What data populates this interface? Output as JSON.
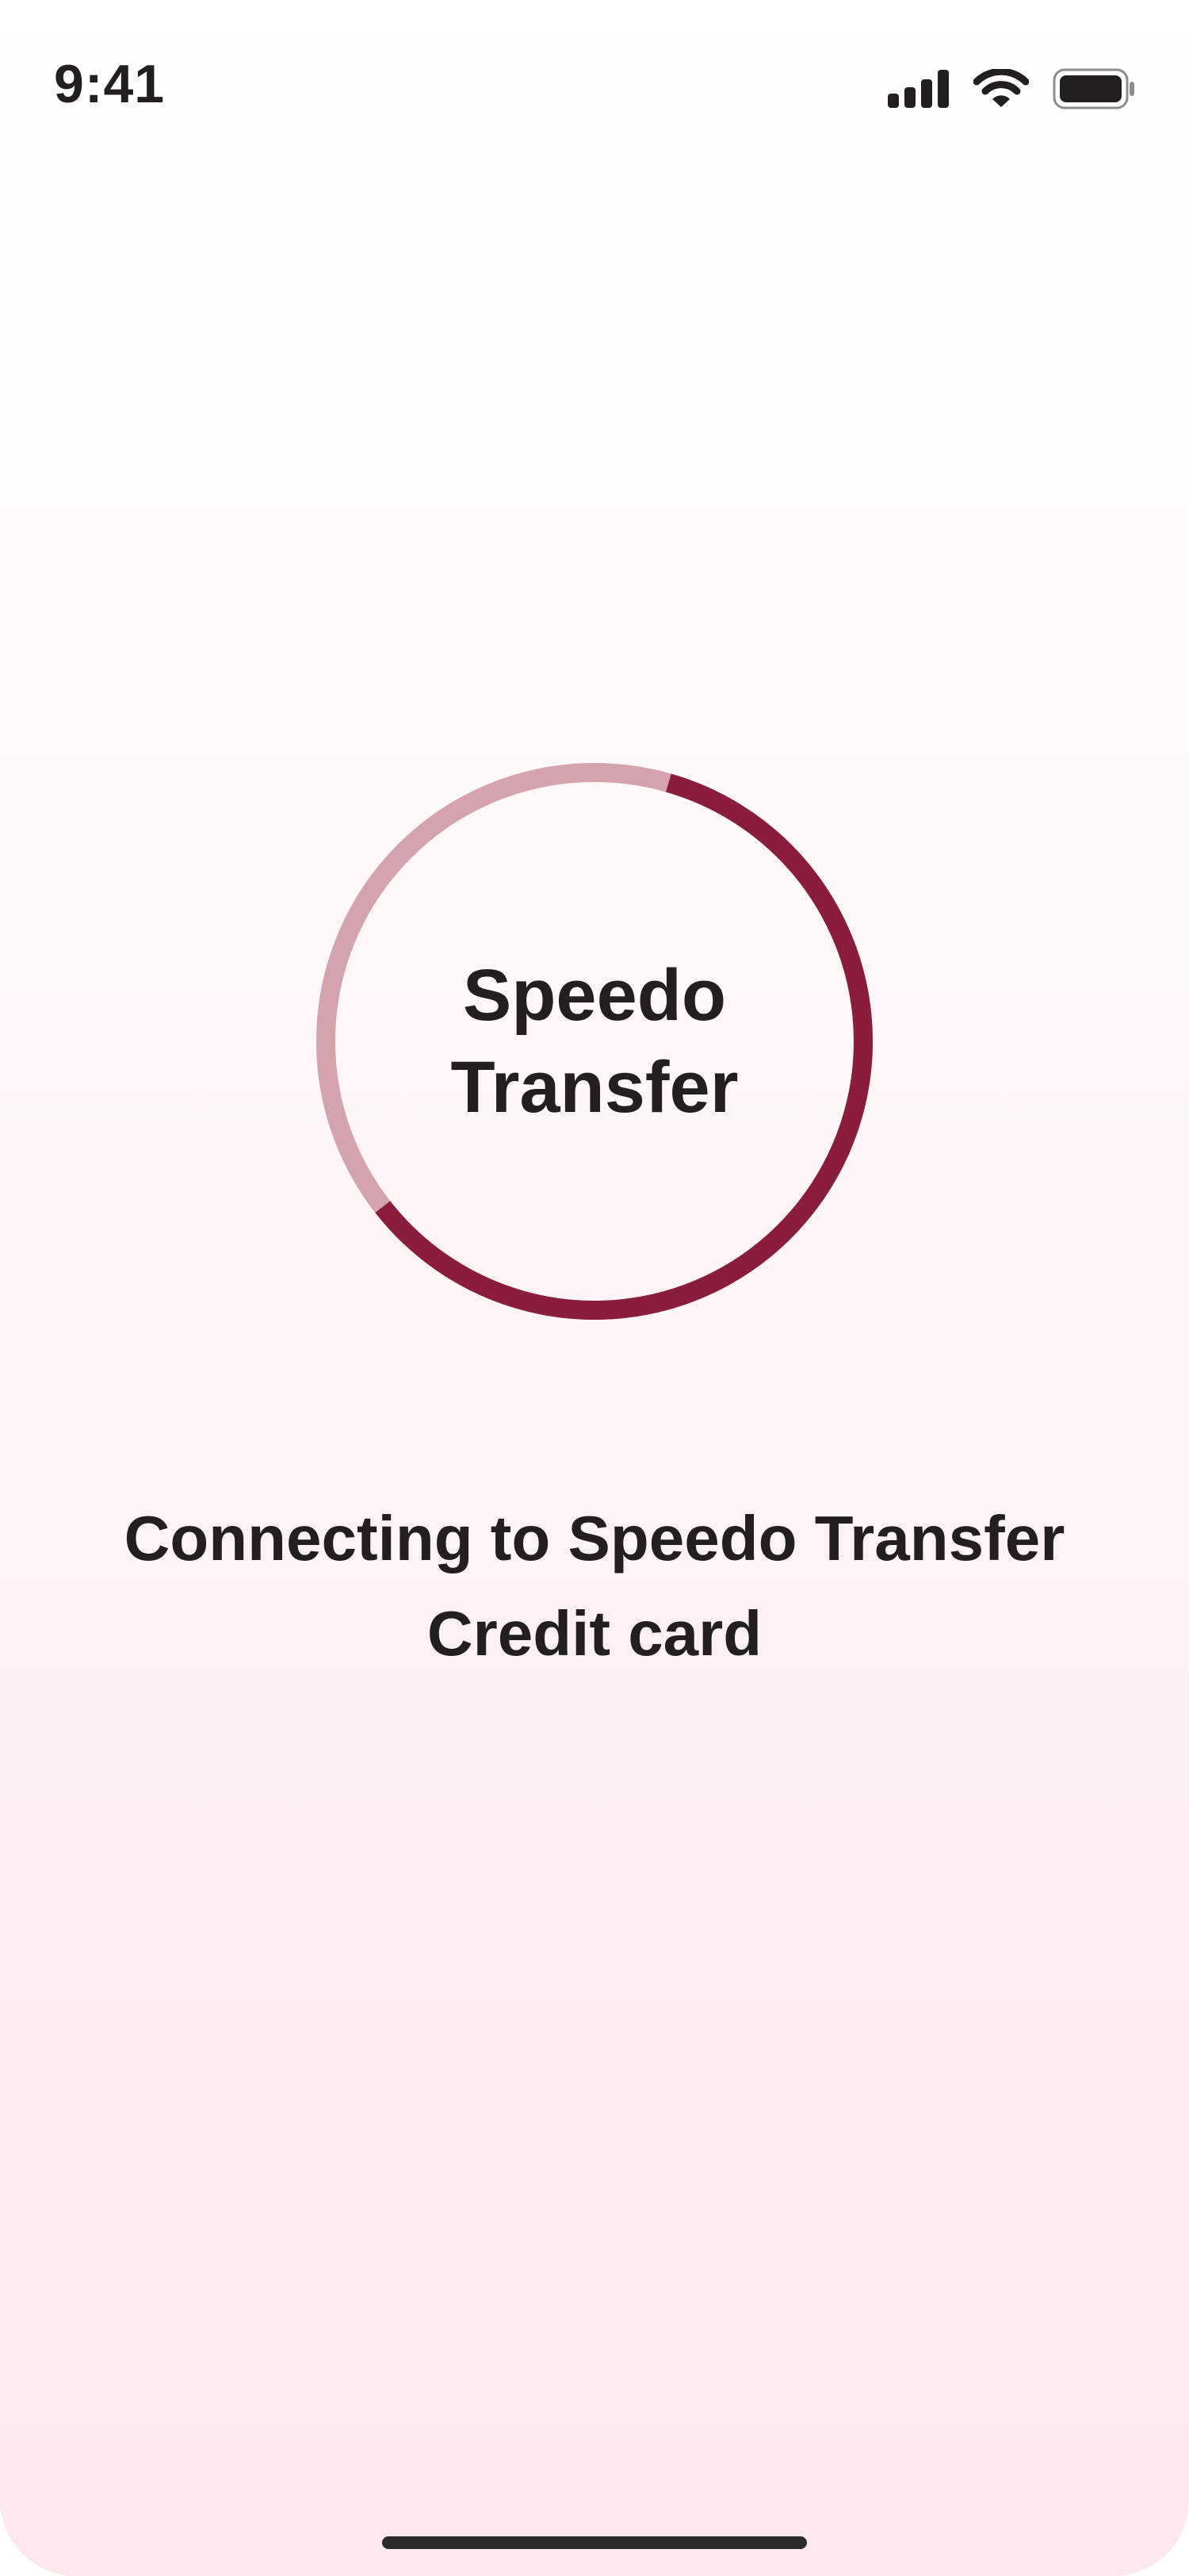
{
  "status_bar": {
    "time": "9:41",
    "icons": [
      "cellular-signal-icon",
      "wifi-icon",
      "battery-icon"
    ]
  },
  "loader": {
    "brand_line1": "Speedo",
    "brand_line2": "Transfer",
    "progress": 0.6,
    "colors": {
      "progress": "#8a1c3c",
      "track": "#d4a3ad"
    }
  },
  "message": {
    "line1": "Connecting to Speedo Transfer",
    "line2": "Credit card"
  },
  "colors": {
    "text": "#231f20",
    "background_top": "#ffffff",
    "background_bottom": "#fde8ec"
  }
}
